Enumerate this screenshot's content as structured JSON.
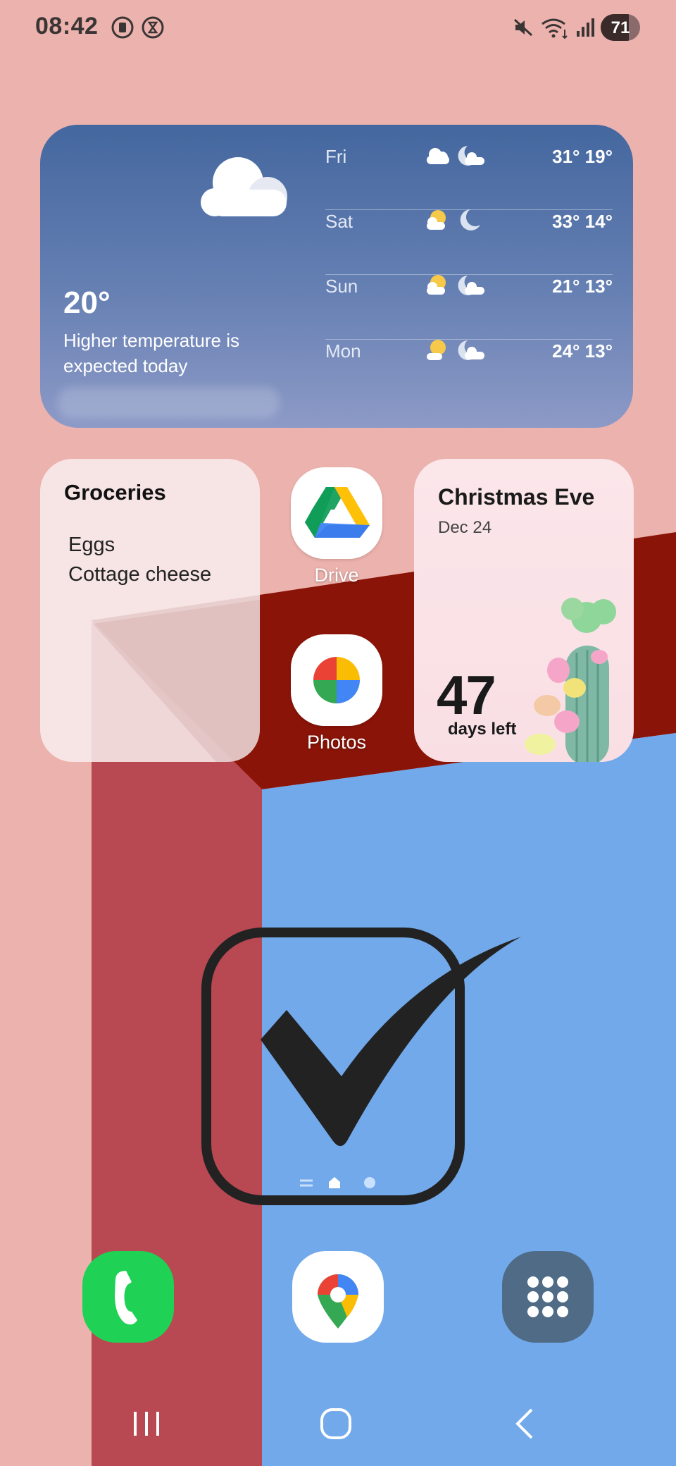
{
  "status_bar": {
    "time": "08:42",
    "battery_level": "71"
  },
  "weather": {
    "current_temp": "20°",
    "description": "Higher temperature is expected today",
    "current_icon": "cloud-icon",
    "forecast": [
      {
        "day": "Fri",
        "temps": "31° 19°",
        "day_icon": "cloud-icon",
        "night_icon": "cloudy-moon-icon"
      },
      {
        "day": "Sat",
        "temps": "33° 14°",
        "day_icon": "partly-sunny-icon",
        "night_icon": "moon-icon"
      },
      {
        "day": "Sun",
        "temps": "21° 13°",
        "day_icon": "partly-sunny-icon",
        "night_icon": "cloudy-moon-icon"
      },
      {
        "day": "Mon",
        "temps": "24° 13°",
        "day_icon": "partly-sunny-icon",
        "night_icon": "cloudy-moon-icon"
      }
    ]
  },
  "groceries": {
    "title": "Groceries",
    "items": [
      "Eggs",
      "Cottage cheese"
    ]
  },
  "apps": {
    "drive": {
      "label": "Drive"
    },
    "photos": {
      "label": "Photos"
    }
  },
  "countdown": {
    "event": "Christmas Eve",
    "date": "Dec 24",
    "days": "47",
    "days_label": "days left"
  },
  "dock": {
    "phone_icon": "phone-icon",
    "maps_icon": "maps-pin-icon",
    "apps_icon": "app-grid-icon"
  },
  "colors": {
    "wallpaper_pink": "#ecb2ad",
    "wallpaper_darkred": "#8a1408",
    "wallpaper_red": "#b84852",
    "wallpaper_blue": "#72a9ea"
  }
}
